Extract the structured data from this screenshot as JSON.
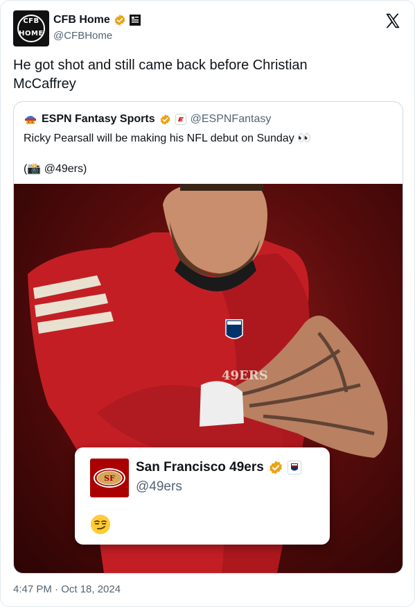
{
  "author": {
    "avatar_line1": "CFB",
    "avatar_line2": "HOME",
    "name": "CFB Home",
    "handle": "@CFBHome"
  },
  "tweet": {
    "text": "He got shot and still came back before Christian McCaffrey",
    "timestamp": "4:47 PM · Oct 18, 2024"
  },
  "quoted": {
    "name": "ESPN Fantasy Sports",
    "handle": "@ESPNFantasy",
    "text": "Ricky Pearsall will be making his NFL debut on Sunday 👀",
    "credit": "(📸 @49ers)"
  },
  "overlay": {
    "name": "San Francisco 49ers",
    "handle": "@49ers",
    "reaction": "smirk-emoji"
  },
  "colors": {
    "verified": "#e8a317",
    "team_red": "#aa0000",
    "muted_text": "#536471"
  },
  "icons": [
    "x-logo-icon",
    "verified-badge-icon",
    "affiliate-badge-icon",
    "espn-badge-icon",
    "nfl-badge-icon",
    "smirk-emoji-icon"
  ]
}
